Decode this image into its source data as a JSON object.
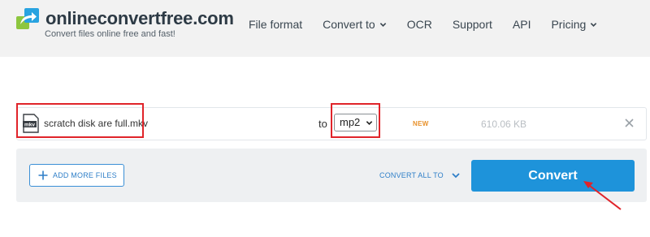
{
  "brand": {
    "name": "onlineconvertfree.com",
    "tagline": "Convert files online free and fast!",
    "colors": {
      "green": "#8dc63f",
      "blue": "#29a3e0"
    }
  },
  "nav": {
    "items": [
      {
        "label": "File format",
        "has_dropdown": false
      },
      {
        "label": "Convert to",
        "has_dropdown": true
      },
      {
        "label": "OCR",
        "has_dropdown": false
      },
      {
        "label": "Support",
        "has_dropdown": false
      },
      {
        "label": "API",
        "has_dropdown": false
      },
      {
        "label": "Pricing",
        "has_dropdown": true
      }
    ]
  },
  "file": {
    "icon_label": "mkv",
    "name": "scratch disk are full.mkv",
    "to_label": "to",
    "target_format": "mp2",
    "badge": "NEW",
    "size": "610.06 KB"
  },
  "actions": {
    "add_more_label": "ADD MORE FILES",
    "convert_all_label": "CONVERT ALL TO",
    "convert_label": "Convert"
  },
  "colors": {
    "accent": "#1e93da",
    "highlight": "#e0242a",
    "badge": "#e8912b"
  }
}
